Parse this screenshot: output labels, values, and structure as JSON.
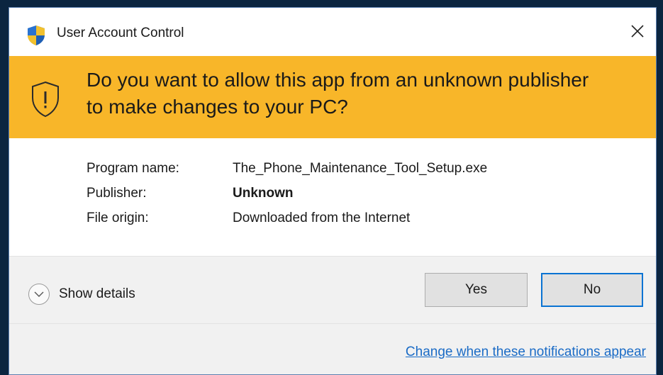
{
  "titlebar": {
    "title": "User Account Control",
    "icon": "uac-shield-icon",
    "close_icon": "close-icon"
  },
  "banner": {
    "question": "Do you want to allow this app from an unknown publisher to make changes to your PC?",
    "icon": "warning-shield-icon",
    "color": "#f8b629"
  },
  "info": {
    "program_label": "Program name:",
    "program_value": "The_Phone_Maintenance_Tool_Setup.exe",
    "publisher_label": "Publisher:",
    "publisher_value": "Unknown",
    "origin_label": "File origin:",
    "origin_value": "Downloaded from the Internet"
  },
  "footer": {
    "details_label": "Show details",
    "details_icon": "chevron-down-icon",
    "yes_label": "Yes",
    "no_label": "No",
    "link_label": "Change when these notifications appear",
    "link_color": "#1a6bc6",
    "focus_color": "#0a73d3"
  }
}
